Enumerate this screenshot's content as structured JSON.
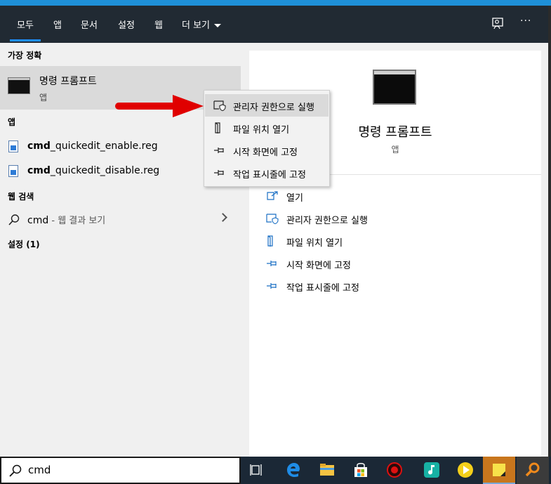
{
  "header": {
    "tabs": [
      {
        "label": "모두",
        "active": true
      },
      {
        "label": "앱"
      },
      {
        "label": "문서"
      },
      {
        "label": "설정"
      },
      {
        "label": "웹"
      },
      {
        "label": "더 보기"
      }
    ],
    "icons": [
      "feedback-icon",
      "more-options-icon"
    ],
    "more_glyph": "···"
  },
  "left": {
    "best_match_heading": "가장 정확",
    "best_match": {
      "title": "명령 프롬프트",
      "subtitle": "앱"
    },
    "apps_heading": "앱",
    "apps": [
      {
        "bold": "cmd",
        "rest": "_quickedit_enable.reg"
      },
      {
        "bold": "cmd",
        "rest": "_quickedit_disable.reg"
      }
    ],
    "web_heading": "웹 검색",
    "web": {
      "query": "cmd",
      "suffix": " - 웹 결과 보기"
    },
    "settings_heading": "설정 (1)"
  },
  "context_menu": {
    "items": [
      {
        "label": "관리자 권한으로 실행",
        "icon": "shield-run-icon"
      },
      {
        "label": "파일 위치 열기",
        "icon": "folder-location-icon"
      },
      {
        "label": "시작 화면에 고정",
        "icon": "pin-icon"
      },
      {
        "label": "작업 표시줄에 고정",
        "icon": "pin-icon"
      }
    ]
  },
  "detail": {
    "title": "명령 프롬프트",
    "subtitle": "앱",
    "actions": [
      {
        "label": "열기",
        "icon": "open-icon"
      },
      {
        "label": "관리자 권한으로 실행",
        "icon": "shield-run-icon"
      },
      {
        "label": "파일 위치 열기",
        "icon": "folder-location-icon"
      },
      {
        "label": "시작 화면에 고정",
        "icon": "pin-icon"
      },
      {
        "label": "작업 표시줄에 고정",
        "icon": "pin-icon"
      }
    ]
  },
  "search": {
    "value": "cmd"
  },
  "taskbar": {
    "items": [
      "task-view-icon",
      "edge-icon",
      "file-explorer-icon",
      "store-icon",
      "app-red-icon",
      "music-app-icon",
      "media-player-icon",
      "sticky-notes-icon",
      "search-app-icon"
    ]
  },
  "colors": {
    "accent": "#1e90d8",
    "header_bg": "#212a33",
    "link_blue": "#1a6fc4",
    "arrow_red": "#e00000"
  }
}
